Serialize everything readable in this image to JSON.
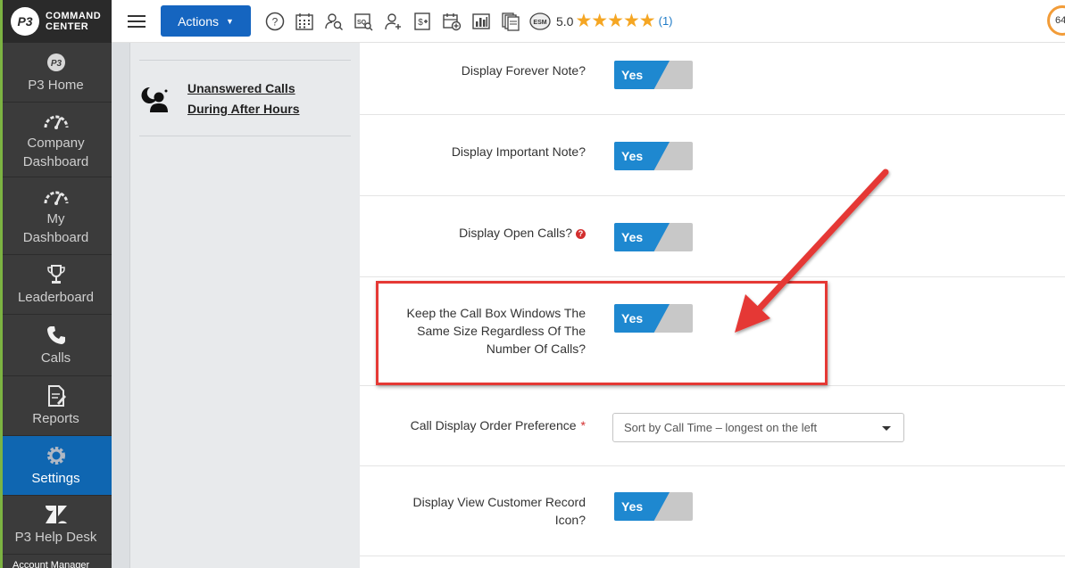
{
  "brand": {
    "logo": "P3",
    "line1": "COMMAND",
    "line2": "CENTER"
  },
  "sidebar": {
    "items": [
      {
        "label": "P3 Home",
        "icon": "p3-logo-icon"
      },
      {
        "label": "Company Dashboard",
        "icon": "gauge-icon"
      },
      {
        "label": "My Dashboard",
        "icon": "gauge-icon"
      },
      {
        "label": "Leaderboard",
        "icon": "trophy-icon"
      },
      {
        "label": "Calls",
        "icon": "phone-icon"
      },
      {
        "label": "Reports",
        "icon": "report-icon"
      },
      {
        "label": "Settings",
        "icon": "gear-icon",
        "active": true
      },
      {
        "label": "P3 Help Desk",
        "icon": "zendesk-icon"
      }
    ],
    "partial_item": "Account Manager"
  },
  "topbar": {
    "actions_label": "Actions",
    "icons": [
      "help-icon",
      "calendar-icon",
      "user-search-icon",
      "sq-search-icon",
      "add-user-icon",
      "invoice-icon",
      "calendar-add-icon",
      "bar-chart-icon",
      "documents-icon",
      "esm-icon"
    ],
    "rating_value": "5.0",
    "rating_stars": "★★★★★",
    "rating_count": "(1)",
    "corner_badge": "64"
  },
  "secondary_panel": {
    "item_label_line1": "Unanswered Calls",
    "item_label_line2": "During After Hours"
  },
  "settings": {
    "forever_note": {
      "label": "Display Forever Note?",
      "value": "Yes"
    },
    "important_note": {
      "label": "Display Important Note?",
      "value": "Yes"
    },
    "open_calls": {
      "label": "Display Open Calls?",
      "value": "Yes",
      "help": "?"
    },
    "keep_size": {
      "label_line1": "Keep the Call Box Windows The",
      "label_line2": "Same Size Regardless Of The",
      "label_line3": "Number Of Calls?",
      "value": "Yes"
    },
    "order_pref": {
      "label": "Call Display Order Preference",
      "required": "*",
      "value": "Sort by Call Time – longest on the left"
    },
    "customer_icon": {
      "label_line1": "Display View Customer Record",
      "label_line2": "Icon?",
      "value": "Yes"
    }
  },
  "annotation": {
    "color": "#e53935"
  }
}
